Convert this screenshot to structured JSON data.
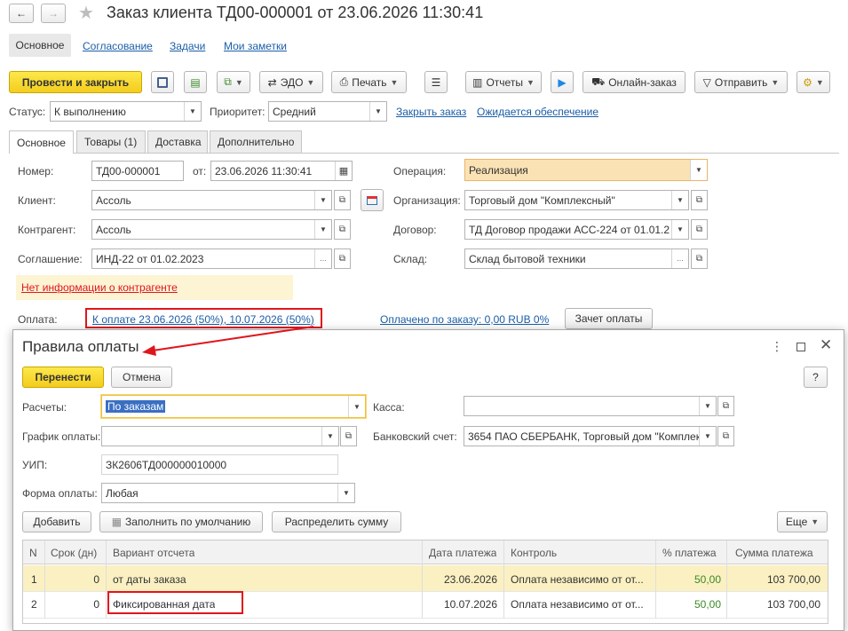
{
  "window": {
    "title": "Заказ клиента ТД00-000001 от 23.06.2026 11:30:41"
  },
  "nav": [
    "Основное",
    "Согласование",
    "Задачи",
    "Мои заметки"
  ],
  "toolbar": {
    "post_close": "Провести и закрыть",
    "edo": "ЭДО",
    "print": "Печать",
    "reports": "Отчеты",
    "online_order": "Онлайн-заказ",
    "send": "Отправить"
  },
  "status": {
    "label": "Статус:",
    "value": "К выполнению",
    "priority_label": "Приоритет:",
    "priority_value": "Средний",
    "close_link": "Закрыть заказ",
    "supply_link": "Ожидается обеспечение"
  },
  "tabs": [
    "Основное",
    "Товары (1)",
    "Доставка",
    "Дополнительно"
  ],
  "form": {
    "number_label": "Номер:",
    "number": "ТД00-000001",
    "from_label": "от:",
    "date": "23.06.2026 11:30:41",
    "operation_label": "Операция:",
    "operation": "Реализация",
    "client_label": "Клиент:",
    "client": "Ассоль",
    "org_label": "Организация:",
    "org": "Торговый дом \"Комплексный\"",
    "counterparty_label": "Контрагент:",
    "counterparty": "Ассоль",
    "contract_label": "Договор:",
    "contract": "ТД Договор продажи АСС-224 от 01.01.2",
    "agreement_label": "Соглашение:",
    "agreement": "ИНД-22 от 01.02.2023",
    "warehouse_label": "Склад:",
    "warehouse": "Склад бытовой техники",
    "warning": "Нет информации о контрагенте",
    "payment_label": "Оплата:",
    "payment_link": "К оплате 23.06.2026 (50%), 10.07.2026 (50%)",
    "paid_link": "Оплачено по заказу: 0,00 RUB 0%",
    "offset_button": "Зачет оплаты"
  },
  "dialog": {
    "title": "Правила оплаты",
    "move_button": "Перенести",
    "cancel_button": "Отмена",
    "help": "?",
    "settlements_label": "Расчеты:",
    "settlements": "По заказам",
    "cash_label": "Касса:",
    "cash": "",
    "schedule_label": "График оплаты:",
    "schedule": "",
    "bank_label": "Банковский счет:",
    "bank": "3654 ПАО СБЕРБАНК, Торговый дом \"Комплек",
    "uip_label": "УИП:",
    "uip": "ЗК2606ТД000000010000",
    "form_label": "Форма оплаты:",
    "form_value": "Любая",
    "add_button": "Добавить",
    "fill_button": "Заполнить по умолчанию",
    "distribute_button": "Распределить сумму",
    "more_button": "Еще",
    "columns": [
      "N",
      "Срок (дн)",
      "Вариант отсчета",
      "Дата платежа",
      "Контроль",
      "% платежа",
      "Сумма платежа"
    ],
    "rows": [
      {
        "n": "1",
        "days": "0",
        "variant": "от даты заказа",
        "date": "23.06.2026",
        "control": "Оплата независимо от от...",
        "pct": "50,00",
        "sum": "103 700,00"
      },
      {
        "n": "2",
        "days": "0",
        "variant": "Фиксированная дата",
        "date": "10.07.2026",
        "control": "Оплата независимо от от...",
        "pct": "50,00",
        "sum": "103 700,00"
      }
    ]
  },
  "colors": {
    "accent_yellow": "#f5d327",
    "link": "#1b5ea7",
    "highlight_red": "#e0151c",
    "row_selected": "#fbf0c2",
    "pct_green": "#3b8a26"
  }
}
